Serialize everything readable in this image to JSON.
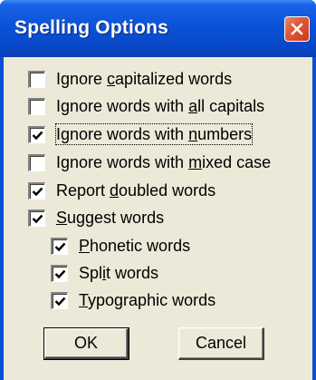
{
  "window": {
    "title": "Spelling Options",
    "close_icon": "close-icon"
  },
  "options": [
    {
      "label_pre": "Ignore ",
      "mnemonic": "c",
      "label_post": "apitalized words",
      "checked": false
    },
    {
      "label_pre": "Ignore words with ",
      "mnemonic": "a",
      "label_post": "ll capitals",
      "checked": false
    },
    {
      "label_pre": "Ignore words with ",
      "mnemonic": "n",
      "label_post": "umbers",
      "checked": true,
      "focused": true
    },
    {
      "label_pre": "Ignore words with ",
      "mnemonic": "m",
      "label_post": "ixed case",
      "checked": false
    },
    {
      "label_pre": "Report ",
      "mnemonic": "d",
      "label_post": "oubled words",
      "checked": true
    },
    {
      "label_pre": "",
      "mnemonic": "S",
      "label_post": "uggest words",
      "checked": true
    }
  ],
  "suggest_options": [
    {
      "label_pre": "",
      "mnemonic": "P",
      "label_post": "honetic words",
      "checked": true
    },
    {
      "label_pre": "Spl",
      "mnemonic": "i",
      "label_post": "t words",
      "checked": true
    },
    {
      "label_pre": "",
      "mnemonic": "T",
      "label_post": "ypographic words",
      "checked": true
    }
  ],
  "buttons": {
    "ok_label": "OK",
    "cancel_label": "Cancel"
  },
  "colors": {
    "titlebar": "#0a52d8",
    "client": "#ece9d8",
    "close": "#e05a3a"
  }
}
